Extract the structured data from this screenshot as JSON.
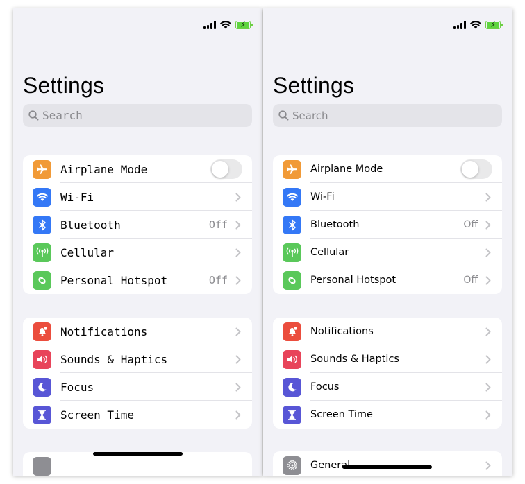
{
  "colors": {
    "background": "#f2f2f7",
    "orange": "#f19a37",
    "blue": "#3478f6",
    "green": "#5ac85a",
    "red": "#eb4d3d",
    "pink": "#e8445a",
    "indigo": "#5856d6",
    "gray": "#8e8e93"
  },
  "status_bar": {
    "icons": [
      "cellular-signal-icon",
      "wifi-icon",
      "battery-charging-icon"
    ]
  },
  "screens": [
    {
      "title": "Settings",
      "search": {
        "placeholder": "Search"
      },
      "group1": [
        {
          "label": "Airplane Mode",
          "icon": "airplane-icon"
        },
        {
          "label": "Wi-Fi",
          "icon": "wifi-icon"
        },
        {
          "label": "Bluetooth",
          "icon": "bluetooth-icon",
          "value": "Off"
        },
        {
          "label": "Cellular",
          "icon": "cellular-antenna-icon"
        },
        {
          "label": "Personal Hotspot",
          "icon": "hotspot-icon",
          "value": "Off"
        }
      ],
      "group2": [
        {
          "label": "Notifications",
          "icon": "notifications-icon"
        },
        {
          "label": "Sounds & Haptics",
          "icon": "sound-icon"
        },
        {
          "label": "Focus",
          "icon": "moon-icon"
        },
        {
          "label": "Screen Time",
          "icon": "hourglass-icon"
        }
      ]
    },
    {
      "title": "Settings",
      "search": {
        "placeholder": "Search"
      },
      "group1": [
        {
          "label": "Airplane Mode",
          "icon": "airplane-icon"
        },
        {
          "label": "Wi-Fi",
          "icon": "wifi-icon"
        },
        {
          "label": "Bluetooth",
          "icon": "bluetooth-icon",
          "value": "Off"
        },
        {
          "label": "Cellular",
          "icon": "cellular-antenna-icon"
        },
        {
          "label": "Personal Hotspot",
          "icon": "hotspot-icon",
          "value": "Off"
        }
      ],
      "group2": [
        {
          "label": "Notifications",
          "icon": "notifications-icon"
        },
        {
          "label": "Sounds & Haptics",
          "icon": "sound-icon"
        },
        {
          "label": "Focus",
          "icon": "moon-icon"
        },
        {
          "label": "Screen Time",
          "icon": "hourglass-icon"
        }
      ],
      "group3": [
        {
          "label": "General",
          "icon": "gear-icon"
        }
      ]
    }
  ]
}
